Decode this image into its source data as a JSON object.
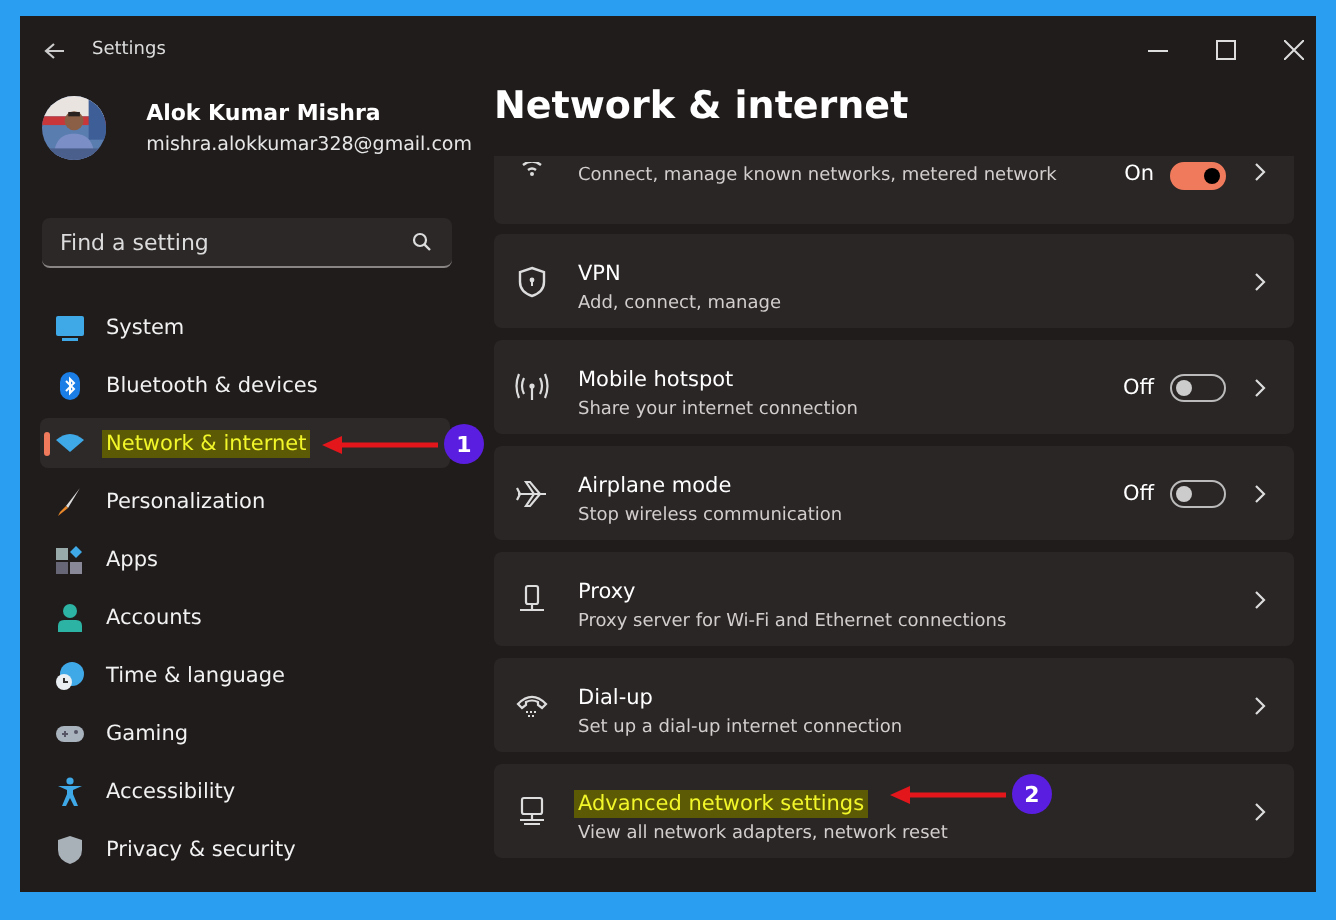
{
  "window": {
    "title": "Settings"
  },
  "account": {
    "name": "Alok Kumar Mishra",
    "email": "mishra.alokkumar328@gmail.com"
  },
  "search": {
    "placeholder": "Find a setting"
  },
  "sidebar": {
    "items": [
      {
        "label": "System",
        "selected": false,
        "highlighted": false
      },
      {
        "label": "Bluetooth & devices",
        "selected": false,
        "highlighted": false
      },
      {
        "label": "Network & internet",
        "selected": true,
        "highlighted": true,
        "callout": "1"
      },
      {
        "label": "Personalization",
        "selected": false,
        "highlighted": false
      },
      {
        "label": "Apps",
        "selected": false,
        "highlighted": false
      },
      {
        "label": "Accounts",
        "selected": false,
        "highlighted": false
      },
      {
        "label": "Time & language",
        "selected": false,
        "highlighted": false
      },
      {
        "label": "Gaming",
        "selected": false,
        "highlighted": false
      },
      {
        "label": "Accessibility",
        "selected": false,
        "highlighted": false
      },
      {
        "label": "Privacy & security",
        "selected": false,
        "highlighted": false
      }
    ]
  },
  "page": {
    "title": "Network & internet"
  },
  "cards": [
    {
      "kind": "clipped",
      "description": "Connect, manage known networks, metered network",
      "toggle": {
        "label": "On",
        "on": true
      },
      "highlighted": false
    },
    {
      "kind": "full",
      "title": "VPN",
      "description": "Add, connect, manage",
      "highlighted": false
    },
    {
      "kind": "full",
      "title": "Mobile hotspot",
      "description": "Share your internet connection",
      "toggle": {
        "label": "Off",
        "on": false
      },
      "highlighted": false
    },
    {
      "kind": "full",
      "title": "Airplane mode",
      "description": "Stop wireless communication",
      "toggle": {
        "label": "Off",
        "on": false
      },
      "highlighted": false
    },
    {
      "kind": "full",
      "title": "Proxy",
      "description": "Proxy server for Wi-Fi and Ethernet connections",
      "highlighted": false
    },
    {
      "kind": "full",
      "title": "Dial-up",
      "description": "Set up a dial-up internet connection",
      "highlighted": false
    },
    {
      "kind": "full",
      "title": "Advanced network settings",
      "description": "View all network adapters, network reset",
      "highlighted": true,
      "callout": "2"
    }
  ]
}
